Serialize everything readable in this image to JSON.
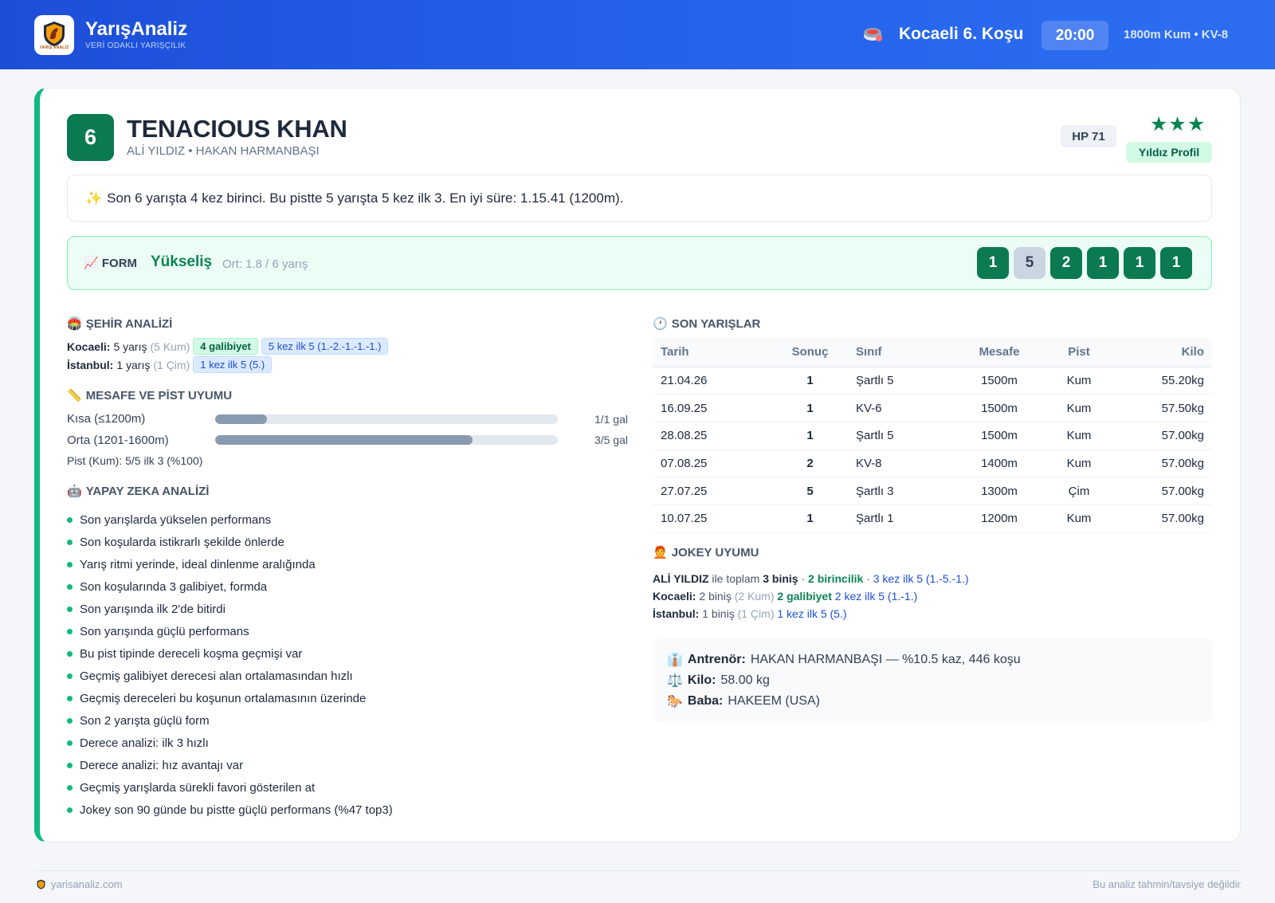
{
  "header": {
    "brand": "YarışAnaliz",
    "tagline": "VERİ ODAKLI YARIŞÇILIK",
    "logo_text": "YARIŞ ANALİZ",
    "race_title": "Kocaeli 6. Koşu",
    "time": "20:00",
    "race_meta": "1800m Kum • KV-8"
  },
  "horse": {
    "number": "6",
    "name": "TENACIOUS KHAN",
    "subtitle": "ALİ YILDIZ • HAKAN HARMANBAŞI",
    "hp": "HP 71",
    "stars": "★★★",
    "profile": "Yıldız Profil"
  },
  "summary": {
    "icon": "✨",
    "text": "Son 6 yarışta 4 kez birinci. Bu pistte 5 yarışta 5 kez ilk 3. En iyi süre: 1.15.41 (1200m)."
  },
  "form": {
    "icon": "📈",
    "label": "FORM",
    "trend": "Yükseliş",
    "avg": "Ort: 1.8 / 6 yarış",
    "results": [
      "1",
      "5",
      "2",
      "1",
      "1",
      "1"
    ]
  },
  "city_analysis": {
    "icon": "🏟️",
    "title": "ŞEHİR ANALİZİ",
    "rows": [
      {
        "city": "Kocaeli:",
        "count": "5 yarış",
        "surface": "(5 Kum)",
        "wins": "4 galibiyet",
        "top5": "5 kez ilk 5 (1.-2.-1.-1.-1.)"
      },
      {
        "city": "İstanbul:",
        "count": "1 yarış",
        "surface": "(1 Çim)",
        "wins": "",
        "top5": "1 kez ilk 5 (5.)"
      }
    ]
  },
  "distance": {
    "icon": "📏",
    "title": "MESAFE VE PİST UYUMU",
    "rows": [
      {
        "label": "Kısa (≤1200m)",
        "value": "1/1 gal",
        "level": 0.15
      },
      {
        "label": "Orta (1201-1600m)",
        "value": "3/5 gal",
        "level": 0.75
      }
    ],
    "pist_note": "Pist (Kum): 5/5 ilk 3 (%100)"
  },
  "ai": {
    "icon": "🤖",
    "title": "YAPAY ZEKA ANALİZİ",
    "items": [
      "Son yarışlarda yükselen performans",
      "Son koşularda istikrarlı şekilde önlerde",
      "Yarış ritmi yerinde, ideal dinlenme aralığında",
      "Son koşularında 3 galibiyet, formda",
      "Son yarışında ilk 2'de bitirdi",
      "Son yarışında güçlü performans",
      "Bu pist tipinde dereceli koşma geçmişi var",
      "Geçmiş galibiyet derecesi alan ortalamasından hızlı",
      "Geçmiş dereceleri bu koşunun ortalamasının üzerinde",
      "Son 2 yarışta güçlü form",
      "Derece analizi: ilk 3 hızlı",
      "Derece analizi: hız avantajı var",
      "Geçmiş yarışlarda sürekli favori gösterilen at",
      "Jokey son 90 günde bu pistte güçlü performans (%47 top3)"
    ]
  },
  "races": {
    "icon": "🕐",
    "title": "SON YARIŞLAR",
    "headers": [
      "Tarih",
      "Sonuç",
      "Sınıf",
      "Mesafe",
      "Pist",
      "Kilo"
    ],
    "rows": [
      [
        "21.04.26",
        "1",
        "Şartlı 5",
        "1500m",
        "Kum",
        "55.20kg"
      ],
      [
        "16.09.25",
        "1",
        "KV-6",
        "1500m",
        "Kum",
        "57.50kg"
      ],
      [
        "28.08.25",
        "1",
        "Şartlı 5",
        "1500m",
        "Kum",
        "57.00kg"
      ],
      [
        "07.08.25",
        "2",
        "KV-8",
        "1400m",
        "Kum",
        "57.00kg"
      ],
      [
        "27.07.25",
        "5",
        "Şartlı 3",
        "1300m",
        "Çim",
        "57.00kg"
      ],
      [
        "10.07.25",
        "1",
        "Şartlı 1",
        "1200m",
        "Kum",
        "57.00kg"
      ]
    ]
  },
  "jockey": {
    "icon": "🧑‍🦰",
    "title": "JOKEY UYUMU",
    "name": "ALİ YILDIZ",
    "total_prefix": "ile toplam",
    "rides": "3 biniş",
    "wins": "2 birincilik",
    "top5": "3 kez ilk 5 (1.-5.-1.)",
    "sep": "·",
    "cities": [
      {
        "city": "Kocaeli:",
        "rides": "2 biniş",
        "surface": "(2 Kum)",
        "wins": "2 galibiyet",
        "top5": "2 kez ilk 5 (1.-1.)"
      },
      {
        "city": "İstanbul:",
        "rides": "1 biniş",
        "surface": "(1 Çim)",
        "wins": "",
        "top5": "1 kez ilk 5 (5.)"
      }
    ]
  },
  "info": {
    "trainer_icon": "👔",
    "trainer_label": "Antrenör:",
    "trainer_value": "HAKAN HARMANBAŞI — %10.5 kaz, 446 koşu",
    "weight_icon": "⚖️",
    "weight_label": "Kilo:",
    "weight_value": "58.00 kg",
    "sire_icon": "🐎",
    "sire_label": "Baba:",
    "sire_value": "HAKEEM (USA)"
  },
  "footer": {
    "site": "yarisanaliz.com",
    "disclaimer": "Bu analiz tahmin/tavsiye değildir"
  },
  "colors": {
    "header_blue": "#2563eb",
    "accent_green": "#0b7a50",
    "place_orange": "#d97706",
    "link_blue": "#1d4ed8"
  }
}
